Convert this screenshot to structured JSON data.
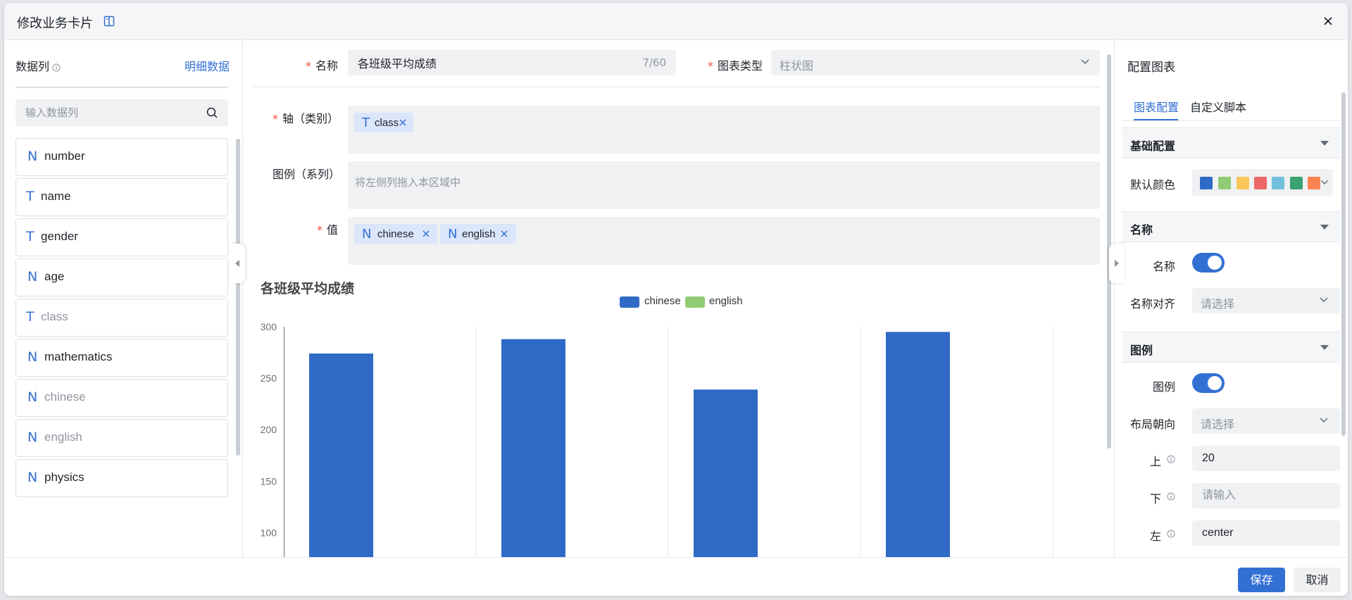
{
  "dialog": {
    "title": "修改业务卡片",
    "close_icon": "close-icon",
    "book_icon": "book-icon"
  },
  "left": {
    "title": "数据列",
    "detail_link": "明细数据",
    "search_placeholder": "输入数据列",
    "fields": [
      {
        "type": "N",
        "name": "number",
        "dim": false
      },
      {
        "type": "T",
        "name": "name",
        "dim": false
      },
      {
        "type": "T",
        "name": "gender",
        "dim": false
      },
      {
        "type": "N",
        "name": "age",
        "dim": false
      },
      {
        "type": "T",
        "name": "class",
        "dim": true
      },
      {
        "type": "N",
        "name": "mathematics",
        "dim": false
      },
      {
        "type": "N",
        "name": "chinese",
        "dim": true
      },
      {
        "type": "N",
        "name": "english",
        "dim": true
      },
      {
        "type": "N",
        "name": "physics",
        "dim": false
      }
    ]
  },
  "form": {
    "name_label": "名称",
    "name_value": "各班级平均成绩",
    "name_count": "7/60",
    "type_label": "图表类型",
    "type_value": "柱状图",
    "axis_label": "轴（类别）",
    "axis_chip": {
      "type": "T",
      "name": "class"
    },
    "legend_label": "图例（系列）",
    "legend_placeholder": "将左侧列拖入本区域中",
    "value_label": "值",
    "value_chips": [
      {
        "type": "N",
        "name": "chinese"
      },
      {
        "type": "N",
        "name": "english"
      }
    ]
  },
  "chart_data": {
    "type": "bar",
    "title": "各班级平均成绩",
    "categories": [
      "",
      "",
      "",
      ""
    ],
    "series": [
      {
        "name": "chinese",
        "values": [
          274,
          288,
          239,
          295
        ]
      },
      {
        "name": "english",
        "values": [
          null,
          null,
          null,
          null
        ]
      }
    ],
    "yticks": [
      "300",
      "250",
      "200",
      "150",
      "100"
    ],
    "ylim_visible": [
      100,
      300
    ],
    "colors": {
      "chinese": "#2f6ac6",
      "english": "#91cc75"
    },
    "legend_position": "top-center",
    "grid": "vertical"
  },
  "config": {
    "title": "配置图表",
    "tabs": [
      "图表配置",
      "自定义脚本"
    ],
    "sections": {
      "basic": "基础配置",
      "name": "名称",
      "legend": "图例"
    },
    "default_color_label": "默认颜色",
    "palette": [
      "#2f6ac6",
      "#91cc75",
      "#fac858",
      "#ee6666",
      "#73c0de",
      "#3ba272",
      "#fc8452"
    ],
    "name_toggle_label": "名称",
    "name_toggle_on": true,
    "name_align_label": "名称对齐",
    "select_placeholder": "请选择",
    "legend_toggle_label": "图例",
    "legend_toggle_on": true,
    "layout_label": "布局朝向",
    "top_label": "上",
    "top_value": "20",
    "bottom_label": "下",
    "input_placeholder": "请输入",
    "left_label": "左",
    "left_value": "center",
    "accent": "#3370d3"
  },
  "footer": {
    "save": "保存",
    "cancel": "取消"
  }
}
